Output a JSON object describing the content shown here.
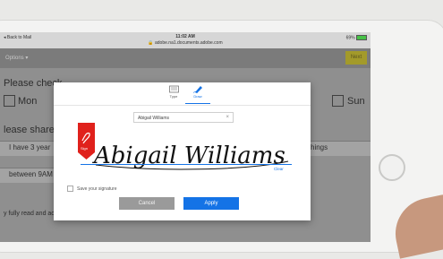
{
  "statusbar": {
    "back": "Back to Mail",
    "time": "11:02 AM",
    "url": "adobe.na1.documents.adobe.com",
    "battery": "69%"
  },
  "toolbar": {
    "options": "Options ▾",
    "next": "Next"
  },
  "background": {
    "please_check": "Please check",
    "mon": "Mon",
    "sun": "Sun",
    "please_share": "lease share d",
    "i_have": "I have 3 year",
    "things": "hings",
    "between": "between 9AM",
    "agreement": "y fully read and accept the Care Center's training regarding training, volunteering, and liability."
  },
  "modal": {
    "tabs": [
      {
        "label": "Type",
        "icon": "keyboard-icon"
      },
      {
        "label": "Draw",
        "icon": "pen-icon"
      }
    ],
    "name_value": "Abigail Williams",
    "signature_text": "Abigail Williams",
    "clear_label": "Clear",
    "save_label": "Save your signature",
    "cancel_label": "Cancel",
    "apply_label": "Apply",
    "accent_color": "#1473e6",
    "flag_color": "#e0211c"
  }
}
